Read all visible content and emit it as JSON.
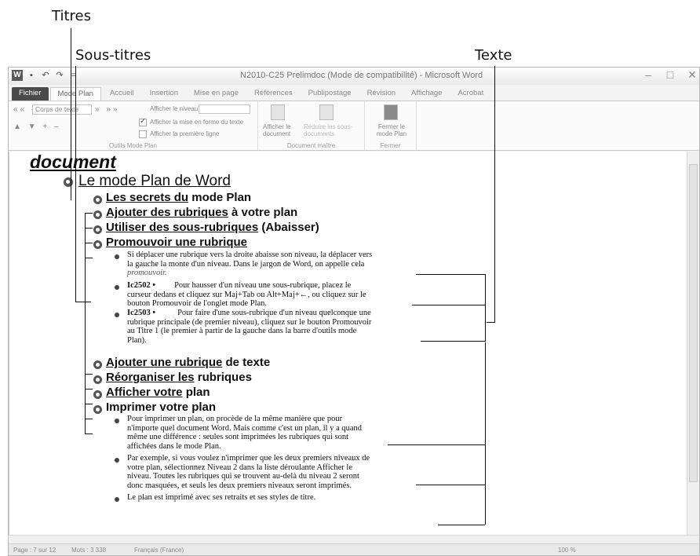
{
  "callouts": {
    "titres": "Titres",
    "sous_titres": "Sous-titres",
    "texte": "Texte"
  },
  "window": {
    "title": "N2010-C25 Prelimdoc (Mode de compatibilité) - Microsoft Word",
    "quick_access": {
      "logo": "W",
      "save": "▪",
      "undo": "↶",
      "redo": "↷",
      "more": "="
    },
    "controls": {
      "minimize": "–",
      "maximize": "□",
      "close": "✕"
    }
  },
  "tabs": [
    "Fichier",
    "Mode Plan",
    "Accueil",
    "Insertion",
    "Mise en page",
    "Références",
    "Publipostage",
    "Révision",
    "Affichage",
    "Acrobat"
  ],
  "ribbon": {
    "level_select": "Corps de texte",
    "show_level": "Afficher le niveau :",
    "show_format": "Afficher la mise en forme du texte",
    "show_first_line": "Afficher la première ligne",
    "group_outline": "Outils Mode Plan",
    "show_document": "Afficher le document",
    "subdocs": "Réduire les sous-documents",
    "group_master": "Document maître",
    "close_plan": "Fermer le mode Plan",
    "group_close": "Fermer"
  },
  "document": {
    "heading_doc": "document",
    "h1": "Le mode Plan de Word",
    "h2": [
      {
        "pre": "",
        "ul": "Les secrets du",
        "post": " mode Plan"
      },
      {
        "pre": "",
        "ul": "Ajouter des rubriques",
        "post": " à votre plan"
      },
      {
        "pre": "",
        "ul": "Utiliser des sous-rubriques",
        "post": " (Abaisser)"
      },
      {
        "pre": "",
        "ul": "Promouvoir une rubrique",
        "post": ""
      }
    ],
    "para1_l1": "Si déplacer une rubrique vers la droite abaisse son niveau, la déplacer vers",
    "para1_l2": "la gauche la monte d'un niveau. Dans le jargon de Word, on appelle cela",
    "para1_l3": "promouvoir.",
    "para2_tag": "Ic2502 •",
    "para2_l1": "Pour hausser d'un niveau une sous-rubrique, placez le",
    "para2_l2": "curseur dedans et cliquez sur Maj+Tab ou Alt+Maj+←, ou cliquez sur le",
    "para2_l3": "bouton Promouvoir de l'onglet mode Plan.",
    "para3_tag": "Ic2503 •",
    "para3_l1": "Pour faire d'une sous-rubrique d'un niveau quelconque une",
    "para3_l2": "rubrique principale (de premier niveau), cliquez sur le bouton Promouvoir",
    "para3_l3": "au Titre 1 (le premier à partir de la gauche dans la barre d'outils mode",
    "para3_l4": "Plan).",
    "h2b": [
      {
        "ul": "Ajouter une rubrique",
        "post": " de texte"
      },
      {
        "ul": "Réorganiser les",
        "post": " rubriques"
      },
      {
        "ul": "Afficher votre",
        "post": " plan"
      },
      {
        "ul": "",
        "post": "Imprimer votre plan"
      }
    ],
    "para4_l1": "Pour imprimer un plan, on procède de la même manière que pour",
    "para4_l2": "n'importe quel document Word. Mais comme c'est un plan, il y a quand",
    "para4_l3": "même une différence : seules sont imprimées les rubriques qui sont",
    "para4_l4": "affichées dans le mode Plan.",
    "para5_l1": "Par exemple, si vous voulez n'imprimer que les deux premiers niveaux de",
    "para5_l2": "votre plan, sélectionnez Niveau 2 dans la liste déroulante Afficher le",
    "para5_l3": "niveau. Toutes les rubriques qui se trouvent au-delà du niveau 2 seront",
    "para5_l4": "donc masquées, et seuls les deux premiers niveaux seront imprimés.",
    "para6_l1": "Le plan est imprimé avec ses retraits et ses styles de titre."
  },
  "status": {
    "page": "Page : 7 sur 12",
    "words": "Mots : 3 338",
    "lang": "Français (France)",
    "zoom": "100 %"
  }
}
